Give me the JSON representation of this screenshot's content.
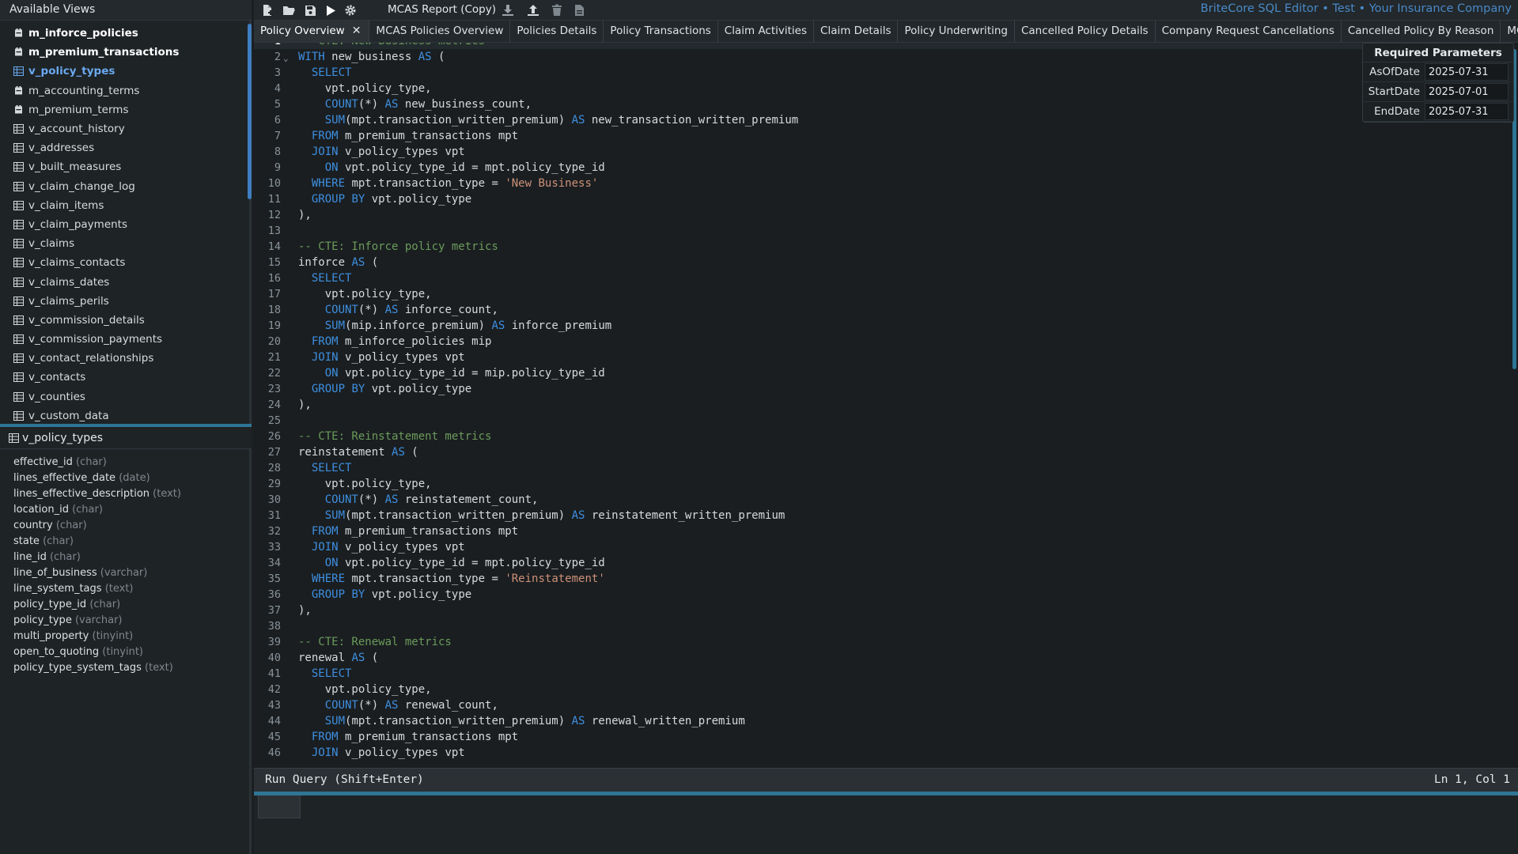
{
  "sidebar": {
    "header": "Available Views",
    "views": [
      {
        "name": "m_inforce_policies",
        "style": "bold",
        "icon": "cube-icon"
      },
      {
        "name": "m_premium_transactions",
        "style": "bold",
        "icon": "cube-icon"
      },
      {
        "name": "v_policy_types",
        "style": "active",
        "icon": "table-icon"
      },
      {
        "name": "m_accounting_terms",
        "style": "normal",
        "icon": "cube-icon"
      },
      {
        "name": "m_premium_terms",
        "style": "normal",
        "icon": "cube-icon"
      },
      {
        "name": "v_account_history",
        "style": "normal",
        "icon": "table-icon"
      },
      {
        "name": "v_addresses",
        "style": "normal",
        "icon": "table-icon"
      },
      {
        "name": "v_built_measures",
        "style": "normal",
        "icon": "table-icon"
      },
      {
        "name": "v_claim_change_log",
        "style": "normal",
        "icon": "table-icon"
      },
      {
        "name": "v_claim_items",
        "style": "normal",
        "icon": "table-icon"
      },
      {
        "name": "v_claim_payments",
        "style": "normal",
        "icon": "table-icon"
      },
      {
        "name": "v_claims",
        "style": "normal",
        "icon": "table-icon"
      },
      {
        "name": "v_claims_contacts",
        "style": "normal",
        "icon": "table-icon"
      },
      {
        "name": "v_claims_dates",
        "style": "normal",
        "icon": "table-icon"
      },
      {
        "name": "v_claims_perils",
        "style": "normal",
        "icon": "table-icon"
      },
      {
        "name": "v_commission_details",
        "style": "normal",
        "icon": "table-icon"
      },
      {
        "name": "v_commission_payments",
        "style": "normal",
        "icon": "table-icon"
      },
      {
        "name": "v_contact_relationships",
        "style": "normal",
        "icon": "table-icon"
      },
      {
        "name": "v_contacts",
        "style": "normal",
        "icon": "table-icon"
      },
      {
        "name": "v_counties",
        "style": "normal",
        "icon": "table-icon"
      },
      {
        "name": "v_custom_data",
        "style": "normal",
        "icon": "table-icon"
      }
    ],
    "detail_title": "v_policy_types",
    "columns": [
      {
        "name": "effective_id",
        "type": "(char)"
      },
      {
        "name": "lines_effective_date",
        "type": "(date)"
      },
      {
        "name": "lines_effective_description",
        "type": "(text)"
      },
      {
        "name": "location_id",
        "type": "(char)"
      },
      {
        "name": "country",
        "type": "(char)"
      },
      {
        "name": "state",
        "type": "(char)"
      },
      {
        "name": "line_id",
        "type": "(char)"
      },
      {
        "name": "line_of_business",
        "type": "(varchar)"
      },
      {
        "name": "line_system_tags",
        "type": "(text)"
      },
      {
        "name": "policy_type_id",
        "type": "(char)"
      },
      {
        "name": "policy_type",
        "type": "(varchar)"
      },
      {
        "name": "multi_property",
        "type": "(tinyint)"
      },
      {
        "name": "open_to_quoting",
        "type": "(tinyint)"
      },
      {
        "name": "policy_type_system_tags",
        "type": "(text)"
      }
    ]
  },
  "toolbar": {
    "report_name": "MCAS Report (Copy)",
    "buttons": [
      "new-file-icon",
      "open-folder-icon",
      "save-icon",
      "run-icon",
      "settings-icon",
      "download-icon",
      "upload-icon",
      "trash-icon",
      "document-icon"
    ],
    "app_title": "BriteCore SQL Editor • Test • Your Insurance Company"
  },
  "tabs": [
    {
      "label": "Policy Overview",
      "active": true,
      "closable": true
    },
    {
      "label": "MCAS Policies Overview",
      "active": false
    },
    {
      "label": "Policies Details",
      "active": false
    },
    {
      "label": "Policy Transactions",
      "active": false
    },
    {
      "label": "Claim Activities",
      "active": false
    },
    {
      "label": "Claim Details",
      "active": false
    },
    {
      "label": "Policy Underwriting",
      "active": false
    },
    {
      "label": "Cancelled Policy Details",
      "active": false
    },
    {
      "label": "Company Request Cancellations",
      "active": false
    },
    {
      "label": "Cancelled Policy By Reason",
      "active": false
    },
    {
      "label": "MCAS System",
      "active": false
    }
  ],
  "params": {
    "title": "Required Parameters",
    "rows": [
      {
        "name": "AsOfDate",
        "value": "2025-07-31"
      },
      {
        "name": "StartDate",
        "value": "2025-07-01"
      },
      {
        "name": "EndDate",
        "value": "2025-07-31"
      }
    ]
  },
  "editor": {
    "lines": [
      "-- CTE: New Business metrics",
      "WITH new_business AS (",
      "  SELECT",
      "    vpt.policy_type,",
      "    COUNT(*) AS new_business_count,",
      "    SUM(mpt.transaction_written_premium) AS new_transaction_written_premium",
      "  FROM m_premium_transactions mpt",
      "  JOIN v_policy_types vpt",
      "    ON vpt.policy_type_id = mpt.policy_type_id",
      "  WHERE mpt.transaction_type = 'New Business'",
      "  GROUP BY vpt.policy_type",
      "),",
      "",
      "-- CTE: Inforce policy metrics",
      "inforce AS (",
      "  SELECT",
      "    vpt.policy_type,",
      "    COUNT(*) AS inforce_count,",
      "    SUM(mip.inforce_premium) AS inforce_premium",
      "  FROM m_inforce_policies mip",
      "  JOIN v_policy_types vpt",
      "    ON vpt.policy_type_id = mip.policy_type_id",
      "  GROUP BY vpt.policy_type",
      "),",
      "",
      "-- CTE: Reinstatement metrics",
      "reinstatement AS (",
      "  SELECT",
      "    vpt.policy_type,",
      "    COUNT(*) AS reinstatement_count,",
      "    SUM(mpt.transaction_written_premium) AS reinstatement_written_premium",
      "  FROM m_premium_transactions mpt",
      "  JOIN v_policy_types vpt",
      "    ON vpt.policy_type_id = mpt.policy_type_id",
      "  WHERE mpt.transaction_type = 'Reinstatement'",
      "  GROUP BY vpt.policy_type",
      "),",
      "",
      "-- CTE: Renewal metrics",
      "renewal AS (",
      "  SELECT",
      "    vpt.policy_type,",
      "    COUNT(*) AS renewal_count,",
      "    SUM(mpt.transaction_written_premium) AS renewal_written_premium",
      "  FROM m_premium_transactions mpt",
      "  JOIN v_policy_types vpt"
    ],
    "fold_marker": "⌄"
  },
  "status": {
    "run_label": "Run Query (Shift+Enter)",
    "cursor": "Ln 1, Col 1"
  },
  "colors": {
    "accent": "#2f7595",
    "keyword": "#3e8fe0",
    "comment": "#6b9b5a",
    "string": "#ce9178",
    "title": "#4a89c8"
  }
}
